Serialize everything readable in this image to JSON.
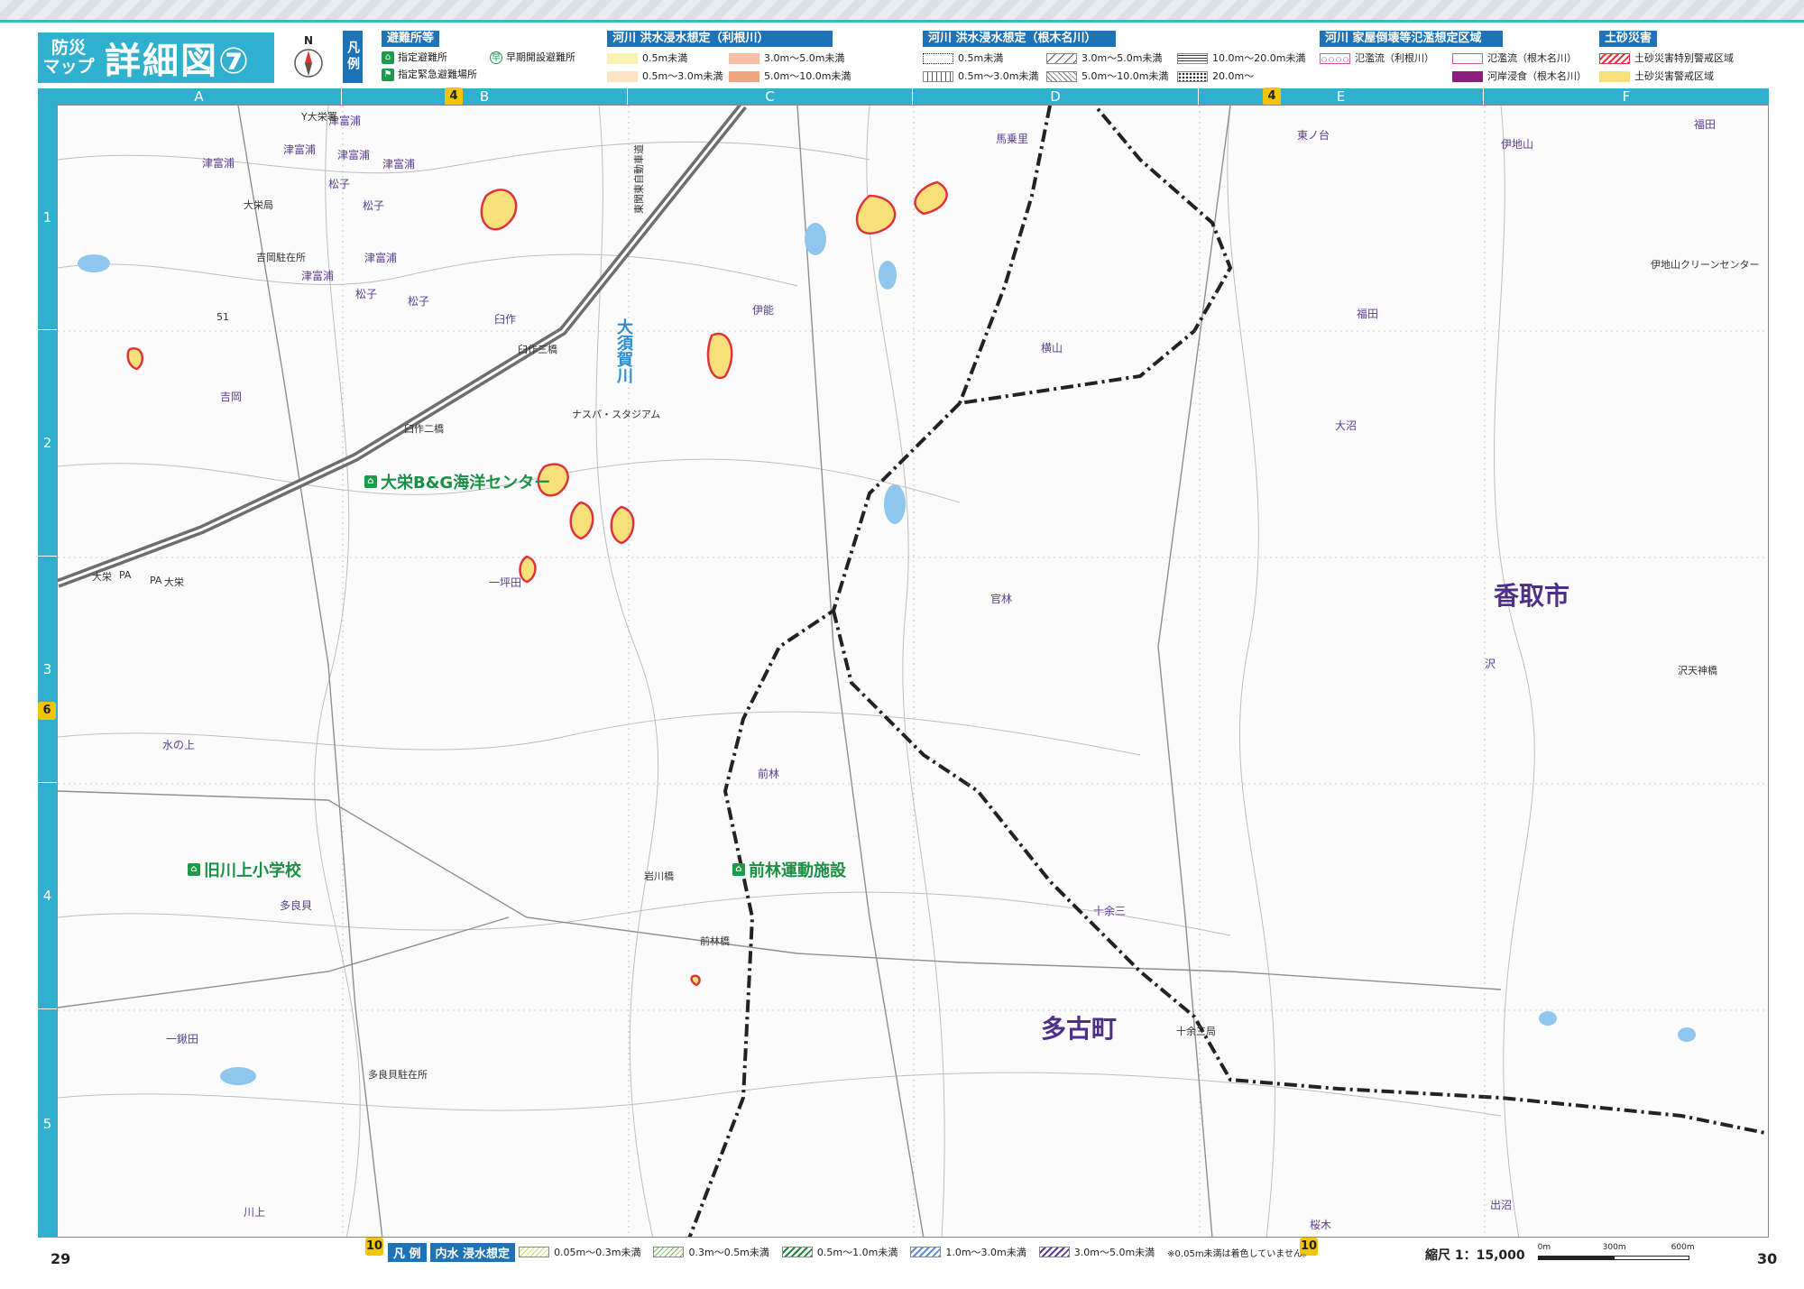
{
  "title": {
    "small": "防災\nマップ",
    "big": "詳細図⑦"
  },
  "north_label": "N",
  "legend_tag": "凡例",
  "legend": {
    "shelter": {
      "head": "避難所等",
      "items": [
        "指定避難所",
        "指定緊急避難場所",
        "早期開設避難所"
      ]
    },
    "tone": {
      "head": "河川 洪水浸水想定（利根川）",
      "items": [
        "0.5m未満",
        "0.5m～3.0m未満",
        "3.0m～5.0m未満",
        "5.0m～10.0m未満"
      ]
    },
    "nekina": {
      "head": "河川 洪水浸水想定（根木名川）",
      "items": [
        "0.5m未満",
        "0.5m～3.0m未満",
        "3.0m～5.0m未満",
        "5.0m～10.0m未満",
        "10.0m～20.0m未満",
        "20.0m～"
      ]
    },
    "collapse": {
      "head": "河川 家屋倒壊等氾濫想定区域",
      "items": [
        "氾濫流（利根川）",
        "氾濫流（根木名川）",
        "河岸浸食（根木名川）"
      ]
    },
    "sediment": {
      "head": "土砂災害",
      "items": [
        "土砂災害特別警戒区域",
        "土砂災害警戒区域"
      ]
    }
  },
  "columns": [
    "A",
    "B",
    "C",
    "D",
    "E",
    "F"
  ],
  "rows": [
    "1",
    "2",
    "3",
    "4",
    "5"
  ],
  "refs": {
    "top_left": "4",
    "top_right": "4",
    "left": "6",
    "bottom_left": "10",
    "bottom_right": "10"
  },
  "map": {
    "places": [
      {
        "t": "津富浦"
      },
      {
        "t": "津富浦"
      },
      {
        "t": "津富浦"
      },
      {
        "t": "津富浦"
      },
      {
        "t": "津富浦"
      },
      {
        "t": "津富浦"
      },
      {
        "t": "津富浦"
      },
      {
        "t": "松子"
      },
      {
        "t": "松子"
      },
      {
        "t": "松子"
      },
      {
        "t": "松子"
      },
      {
        "t": "吉岡"
      },
      {
        "t": "臼作"
      },
      {
        "t": "伊能"
      },
      {
        "t": "馬乗里"
      },
      {
        "t": "横山"
      },
      {
        "t": "東ノ台"
      },
      {
        "t": "伊地山"
      },
      {
        "t": "福田"
      },
      {
        "t": "福田"
      },
      {
        "t": "大沼"
      },
      {
        "t": "一坪田"
      },
      {
        "t": "官林"
      },
      {
        "t": "沢"
      },
      {
        "t": "水の上"
      },
      {
        "t": "前林"
      },
      {
        "t": "多良貝"
      },
      {
        "t": "十余三"
      },
      {
        "t": "一鍬田"
      },
      {
        "t": "川上"
      },
      {
        "t": "桜木"
      },
      {
        "t": "出沼"
      }
    ],
    "big_places": [
      "香取市",
      "多古町"
    ],
    "facilities": [
      "大栄B&G海洋センター",
      "旧川上小学校",
      "前林運動施設"
    ],
    "river": "大須賀川",
    "expressway": "東関東自動車道",
    "landmarks": [
      "ナスパ・スタジアム",
      "伊地山クリーンセンター",
      "吉岡駐在所",
      "多良貝駐在所",
      "十余三局",
      "沢天神橋",
      "岩川橋",
      "前林橋",
      "臼作三橋",
      "臼作二橋",
      "大栄",
      "大栄",
      "PA",
      "PA",
      "51",
      "Y大栄署",
      "大栄局"
    ]
  },
  "page_left": "29",
  "page_right": "30",
  "bottom_legend": {
    "head1": "凡 例",
    "head2": "内水 浸水想定",
    "items": [
      "0.05m～0.3m未満",
      "0.3m～0.5m未満",
      "0.5m～1.0m未満",
      "1.0m～3.0m未満",
      "3.0m～5.0m未満"
    ],
    "note": "※0.05m未満は着色していません。"
  },
  "scale": {
    "label": "縮尺 1：15,000",
    "ticks": [
      "0m",
      "300m",
      "600m"
    ]
  },
  "colors": {
    "accent": "#2fb0ce",
    "legend_head": "#1d72b8",
    "facility": "#1b8f44",
    "place": "#5a3c92",
    "boundary": "#222222",
    "hazard": "#e0343c",
    "hazard_fill": "#f7e07a"
  }
}
